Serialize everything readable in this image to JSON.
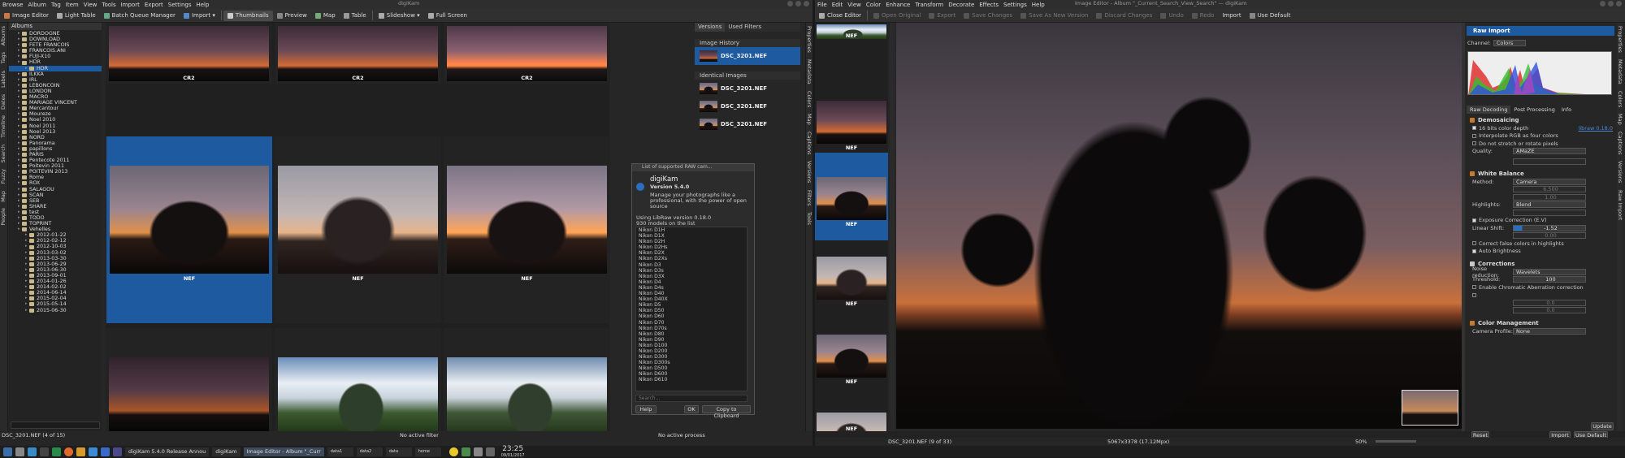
{
  "left_window": {
    "title": "digiKam",
    "menu": [
      "Browse",
      "Album",
      "Tag",
      "Item",
      "View",
      "Tools",
      "Import",
      "Export",
      "Settings",
      "Help"
    ],
    "toolbar": [
      "Image Editor",
      "Light Table",
      "Batch Queue Manager",
      "Import",
      "Thumbnails",
      "Preview",
      "Map",
      "Table",
      "Slideshow",
      "Full Screen"
    ],
    "left_tabs": [
      "Albums",
      "Tags",
      "Labels",
      "Dates",
      "Timeline",
      "Search",
      "Fuzzy",
      "Map",
      "People"
    ],
    "albums_title": "Albums",
    "albums": [
      {
        "label": "DORDOGNE",
        "depth": 1
      },
      {
        "label": "DOWNLOAD",
        "depth": 1
      },
      {
        "label": "FETE FRANCOIS",
        "depth": 1
      },
      {
        "label": "FRANCOIS.ANI",
        "depth": 1
      },
      {
        "label": "FUJI-X10",
        "depth": 1
      },
      {
        "label": "HDR",
        "depth": 1
      },
      {
        "label": "HDR",
        "depth": 2,
        "selected": true
      },
      {
        "label": "ILKKA",
        "depth": 1
      },
      {
        "label": "IRL",
        "depth": 1
      },
      {
        "label": "LEBONCOIN",
        "depth": 1
      },
      {
        "label": "LONDON",
        "depth": 1
      },
      {
        "label": "MACRO",
        "depth": 1
      },
      {
        "label": "MARIAGE VINCENT",
        "depth": 1
      },
      {
        "label": "Mercantour",
        "depth": 1
      },
      {
        "label": "Moureze",
        "depth": 1
      },
      {
        "label": "Noel 2010",
        "depth": 1
      },
      {
        "label": "Noel 2011",
        "depth": 1
      },
      {
        "label": "Noel 2013",
        "depth": 1
      },
      {
        "label": "NORD",
        "depth": 1
      },
      {
        "label": "Panorama",
        "depth": 1
      },
      {
        "label": "papillons",
        "depth": 1
      },
      {
        "label": "PARIS",
        "depth": 1
      },
      {
        "label": "Pentecote 2011",
        "depth": 1
      },
      {
        "label": "Poitevin 2011",
        "depth": 1
      },
      {
        "label": "POITEVIN 2013",
        "depth": 1
      },
      {
        "label": "Rome",
        "depth": 1
      },
      {
        "label": "ROX",
        "depth": 1
      },
      {
        "label": "SALAGOU",
        "depth": 1
      },
      {
        "label": "SCAN",
        "depth": 1
      },
      {
        "label": "SEB",
        "depth": 1
      },
      {
        "label": "SHARE",
        "depth": 1
      },
      {
        "label": "test",
        "depth": 1
      },
      {
        "label": "TODO",
        "depth": 1
      },
      {
        "label": "TOPRINT",
        "depth": 1
      },
      {
        "label": "Vehelles",
        "depth": 1
      },
      {
        "label": "2012-01-22",
        "depth": 2
      },
      {
        "label": "2012-02-12",
        "depth": 2
      },
      {
        "label": "2012-10-03",
        "depth": 2
      },
      {
        "label": "2013-03-02",
        "depth": 2
      },
      {
        "label": "2013-03-30",
        "depth": 2
      },
      {
        "label": "2013-06-29",
        "depth": 2
      },
      {
        "label": "2013-06-30",
        "depth": 2
      },
      {
        "label": "2013-09-01",
        "depth": 2
      },
      {
        "label": "2014-01-26",
        "depth": 2
      },
      {
        "label": "2014-02-02",
        "depth": 2
      },
      {
        "label": "2014-06-14",
        "depth": 2
      },
      {
        "label": "2015-02-04",
        "depth": 2
      },
      {
        "label": "2015-05-14",
        "depth": 2
      },
      {
        "label": "2015-06-30",
        "depth": 2
      }
    ],
    "thumbs_top": [
      "CR2",
      "CR2",
      "CR2"
    ],
    "thumbs_mid": [
      "NEF",
      "NEF",
      "NEF"
    ],
    "versions_tabs": [
      "Versions",
      "Used Filters"
    ],
    "image_history_label": "Image History",
    "identical_images_label": "Identical Images",
    "version_items": [
      "DSC_3201.NEF",
      "DSC_3201.NEF",
      "DSC_3201.NEF",
      "DSC_3201.NEF"
    ],
    "right_tabs": [
      "Properties",
      "Metadata",
      "Colors",
      "Map",
      "Captions",
      "Versions",
      "Filters",
      "Tools"
    ],
    "status_left": "DSC_3201.NEF (4 of 15)",
    "status_filter": "No active filter",
    "status_process": "No active process"
  },
  "about_dialog": {
    "title": "List of supported RAW cam...",
    "app": "digiKam",
    "version": "Version 5.4.0",
    "description": [
      "Manage your photographs like a",
      "professional, with the power of open",
      "source"
    ],
    "libraw": "Using LibRaw version 0.18.0",
    "models_count": "930 models on the list",
    "models": [
      "Nikon D1H",
      "Nikon D1X",
      "Nikon D2H",
      "Nikon D2Hs",
      "Nikon D2X",
      "Nikon D2Xs",
      "Nikon D3",
      "Nikon D3s",
      "Nikon D3X",
      "Nikon D4",
      "Nikon D4s",
      "Nikon D40",
      "Nikon D40X",
      "Nikon D5",
      "Nikon D50",
      "Nikon D60",
      "Nikon D70",
      "Nikon D70s",
      "Nikon D80",
      "Nikon D90",
      "Nikon D100",
      "Nikon D200",
      "Nikon D300",
      "Nikon D300s",
      "Nikon D500",
      "Nikon D600",
      "Nikon D610"
    ],
    "search_placeholder": "Search...",
    "buttons": [
      "Help",
      "OK",
      "Copy to Clipboard"
    ]
  },
  "right_window": {
    "title": "Image Editor - Album \"_Current_Search_View_Search\" — digiKam",
    "menu": [
      "File",
      "Edit",
      "View",
      "Color",
      "Enhance",
      "Transform",
      "Decorate",
      "Effects",
      "Settings",
      "Help"
    ],
    "toolbar": [
      "Close Editor",
      "Open Original",
      "Export",
      "Save Changes",
      "Save As New Version",
      "Discard Changes",
      "Undo",
      "Redo",
      "Import",
      "Use Default"
    ],
    "film_labels": [
      "NEF",
      "NEF",
      "NEF",
      "NEF",
      "NEF",
      "NEF"
    ],
    "right_tabs": [
      "Properties",
      "Metadata",
      "Colors",
      "Map",
      "Captions",
      "Versions",
      "Raw Import"
    ],
    "panel_title": "Raw Import",
    "channel_label": "Channel:",
    "channel_value": "Colors",
    "panel_tabs": [
      "Raw Decoding",
      "Post Processing",
      "Info"
    ],
    "demosaicing": "Demosaicing",
    "bits_label": "16 bits color depth",
    "libraw_link": "libraw 0.18.0",
    "interp_label": "Interpolate RGB as four colors",
    "stretch_label": "Do not stretch or rotate pixels",
    "quality_label": "Quality:",
    "quality_value": "AMaZE",
    "wb_title": "White Balance",
    "method_label": "Method:",
    "method_value": "Camera",
    "t_value": "6.500",
    "g_value": "1.00",
    "highlights_label": "Highlights:",
    "highlights_value": "Blend",
    "exposure_label": "Exposure Correction (E.V)",
    "linear_label": "Linear Shift:",
    "linear_value": "-1.52",
    "hl_value": "0.00",
    "false_colors": "Correct false colors in highlights",
    "auto_brightness": "Auto Brightness",
    "corrections_title": "Corrections",
    "noise_label": "Noise reduction:",
    "noise_value": "Wavelets",
    "threshold_label": "Threshold:",
    "threshold_value": "100",
    "ca_label": "Enable Chromatic Aberration correction",
    "ca1": "0.0",
    "ca2": "0.0",
    "cm_title": "Color Management",
    "profile_label": "Camera Profile:",
    "profile_value": "None",
    "update_label": "Update",
    "bottom_buttons": [
      "Reset",
      "Import",
      "Use Default"
    ],
    "status_file": "DSC_3201.NEF (9 of 33)",
    "status_size": "5067x3378 (17.12Mpx)",
    "zoom": "50%"
  },
  "taskbar": {
    "tasks": [
      "digiKam 5.4.0 Release Annou",
      "digiKam",
      "Image Editor - Album \"_Curr"
    ],
    "labels": [
      "data1",
      "data2",
      "data",
      "home"
    ],
    "time": "23:25",
    "date": "09/01/2017"
  }
}
